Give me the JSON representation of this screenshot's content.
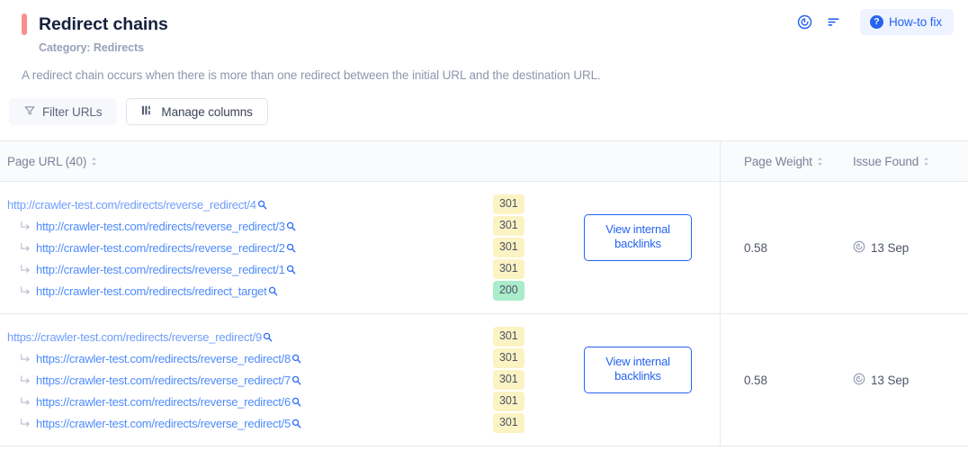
{
  "header": {
    "title": "Redirect chains",
    "category": "Category: Redirects",
    "description": "A redirect chain occurs when there is more than one redirect between the initial URL and the destination URL.",
    "accent_color": "#f98f8a",
    "actions": {
      "crawl_icon": "crawl-spiral-icon",
      "sort_icon": "sort-lines-icon",
      "howto_label": "How-to fix",
      "howto_icon": "question-mark-icon"
    }
  },
  "toolbar": {
    "filter_label": "Filter URLs",
    "filter_icon": "funnel-icon",
    "manage_label": "Manage columns",
    "manage_icon": "columns-icon"
  },
  "table": {
    "columns": [
      {
        "label": "Page URL (40)",
        "sortable": true
      },
      {
        "label": "Page Weight",
        "sortable": true
      },
      {
        "label": "Issue Found",
        "sortable": true
      }
    ],
    "rows": [
      {
        "chain": [
          {
            "url": "http://crawler-test.com/redirects/reverse_redirect/4",
            "code": "301",
            "code_type": "redirect",
            "sub": false
          },
          {
            "url": "http://crawler-test.com/redirects/reverse_redirect/3",
            "code": "301",
            "code_type": "redirect",
            "sub": true
          },
          {
            "url": "http://crawler-test.com/redirects/reverse_redirect/2",
            "code": "301",
            "code_type": "redirect",
            "sub": true
          },
          {
            "url": "http://crawler-test.com/redirects/reverse_redirect/1",
            "code": "301",
            "code_type": "redirect",
            "sub": true
          },
          {
            "url": "http://crawler-test.com/redirects/redirect_target",
            "code": "200",
            "code_type": "ok",
            "sub": true
          }
        ],
        "backlinks_label": "View internal backlinks",
        "page_weight": "0.58",
        "issue_found": "13 Sep",
        "issue_icon": "crawl-spiral-icon"
      },
      {
        "chain": [
          {
            "url": "https://crawler-test.com/redirects/reverse_redirect/9",
            "code": "301",
            "code_type": "redirect",
            "sub": false
          },
          {
            "url": "https://crawler-test.com/redirects/reverse_redirect/8",
            "code": "301",
            "code_type": "redirect",
            "sub": true
          },
          {
            "url": "https://crawler-test.com/redirects/reverse_redirect/7",
            "code": "301",
            "code_type": "redirect",
            "sub": true
          },
          {
            "url": "https://crawler-test.com/redirects/reverse_redirect/6",
            "code": "301",
            "code_type": "redirect",
            "sub": true
          },
          {
            "url": "https://crawler-test.com/redirects/reverse_redirect/5",
            "code": "301",
            "code_type": "redirect",
            "sub": true
          }
        ],
        "backlinks_label": "View internal backlinks",
        "page_weight": "0.58",
        "issue_found": "13 Sep",
        "issue_icon": "crawl-spiral-icon"
      }
    ]
  },
  "colors": {
    "accent": "#f98f8a",
    "link": "#4e8bfb",
    "primary": "#2563f0",
    "badge_redirect_bg": "#fcf3c3",
    "badge_ok_bg": "#a9ecc9"
  }
}
